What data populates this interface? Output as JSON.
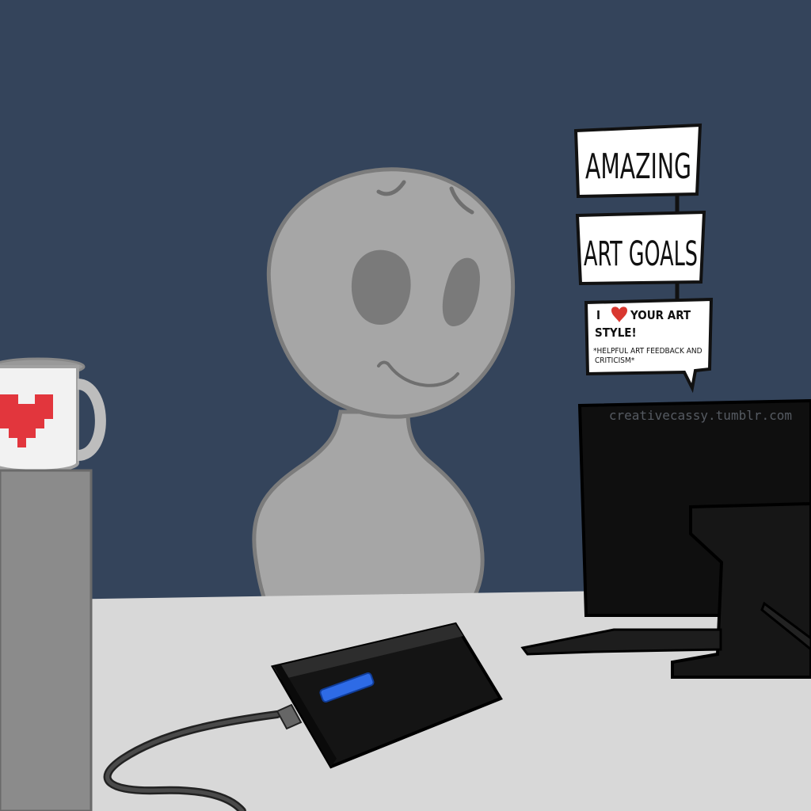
{
  "scene": {
    "colors": {
      "wall": "#34445b",
      "desk": "#d8d8d8",
      "figure": "#a6a6a6",
      "figure_outline": "#707070",
      "mug_heart": "#e2363d",
      "device_light": "#2e6be6"
    }
  },
  "bubbles": {
    "bubble_1": "AMAZING",
    "bubble_2": "ART GOALS",
    "bubble_3_line_1_a": "I",
    "bubble_3_line_1_b": "YOUR ART",
    "bubble_3_line_2": "STYLE!",
    "bubble_3_small_1": "*HELPFUL ART FEEDBACK AND",
    "bubble_3_small_2": "CRITICISM*"
  },
  "watermark": "creativecassy.tumblr.com",
  "icons": {
    "heart": "heart-icon",
    "mug_heart": "pixel-heart-icon"
  }
}
